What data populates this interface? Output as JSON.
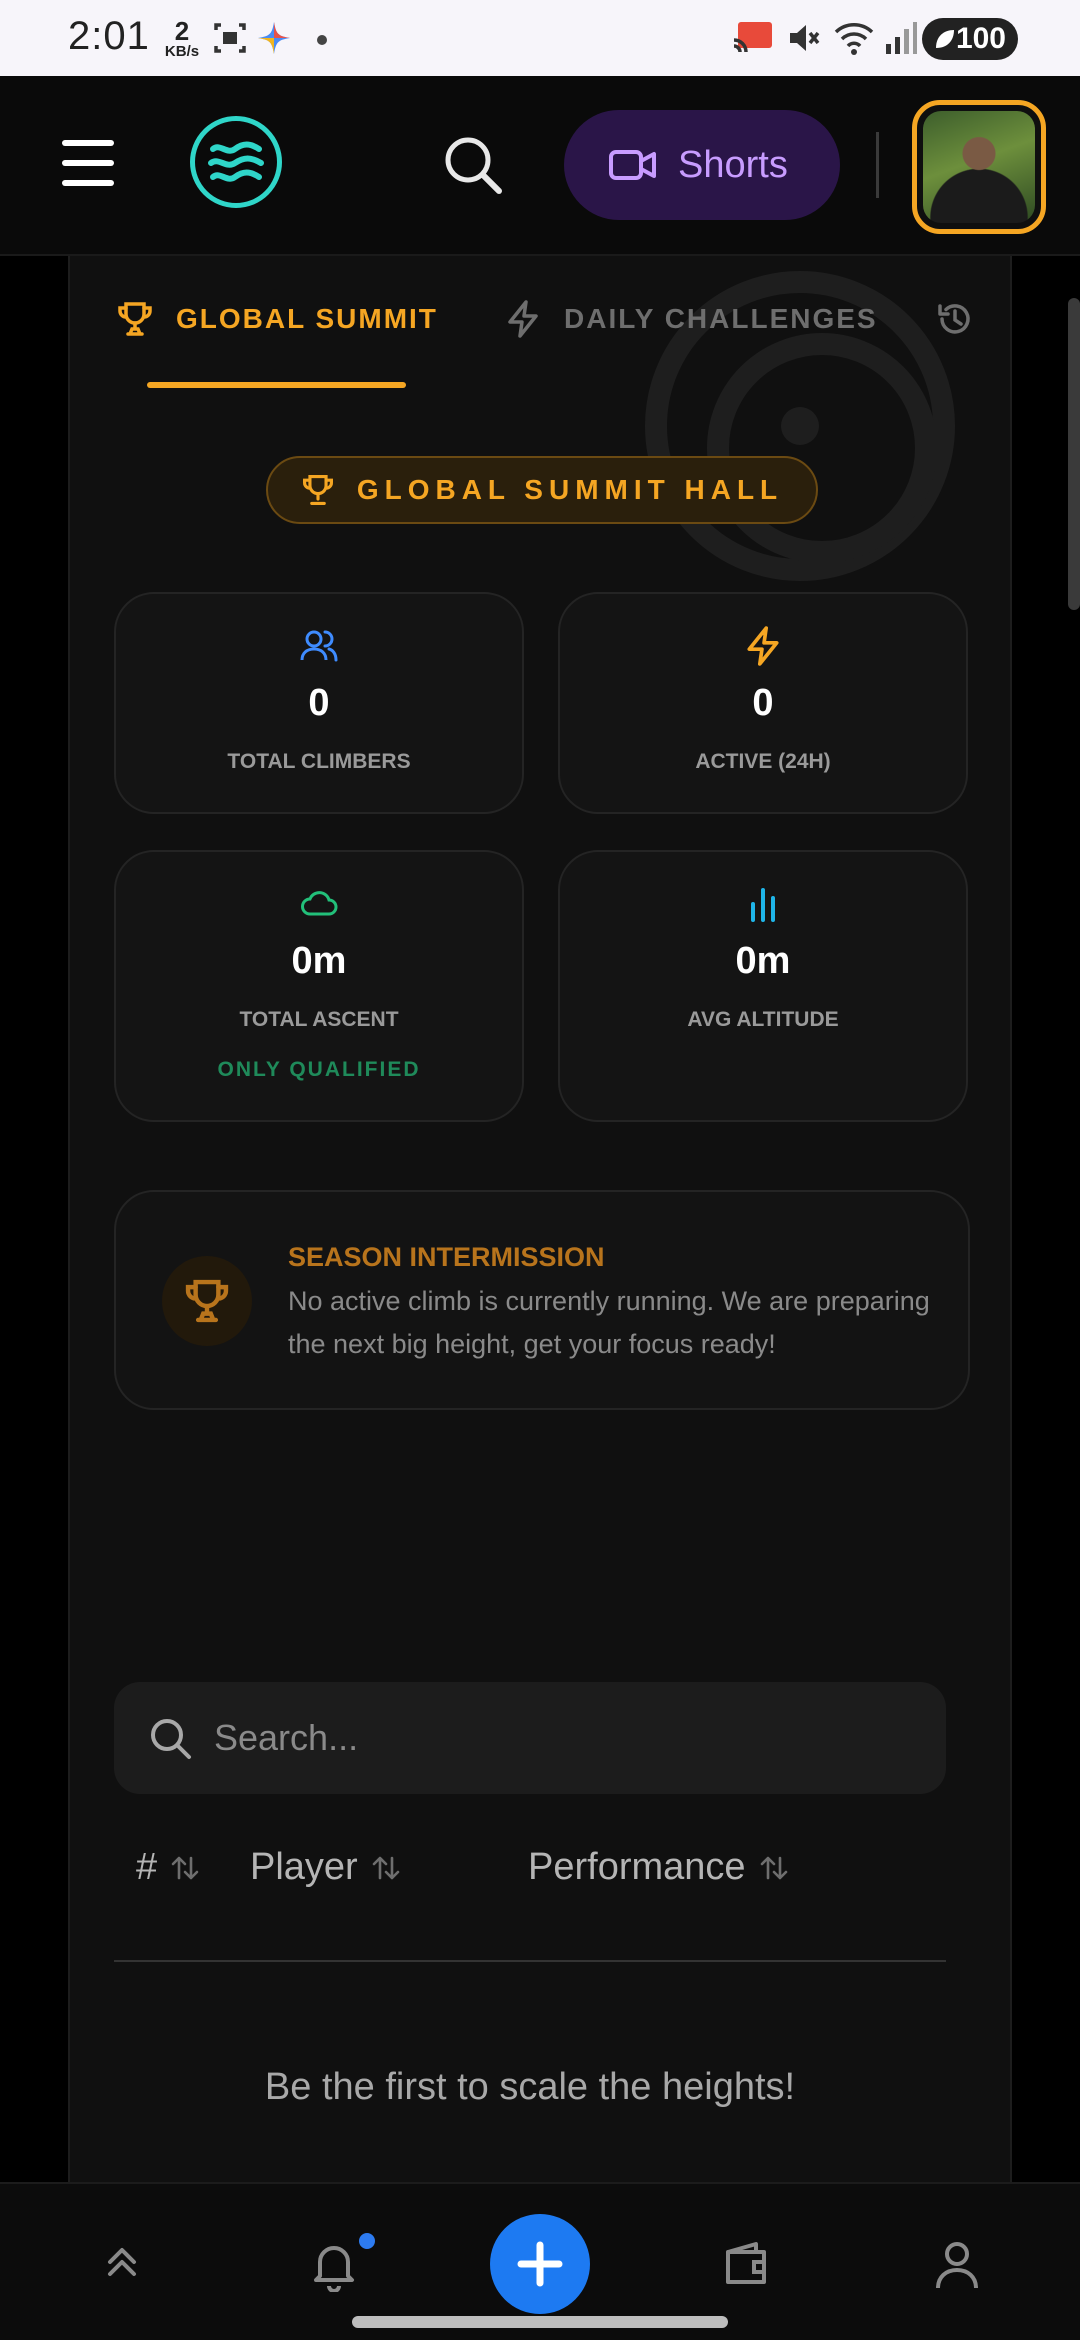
{
  "status_bar": {
    "time": "2:01",
    "net_speed_value": "2",
    "net_speed_unit": "KB/s",
    "battery": "100"
  },
  "header": {
    "shorts_label": "Shorts",
    "icons": [
      "menu-icon",
      "app-logo",
      "search-icon",
      "video-icon",
      "avatar"
    ]
  },
  "tabs": [
    {
      "label": "GLOBAL SUMMIT",
      "icon": "trophy-icon",
      "active": true
    },
    {
      "label": "DAILY CHALLENGES",
      "icon": "lightning-icon",
      "active": false
    }
  ],
  "hall_badge": "GLOBAL SUMMIT HALL",
  "stats": {
    "total_climbers": {
      "value": "0",
      "label": "TOTAL CLIMBERS",
      "icon": "users-icon",
      "color": "#3f8cff"
    },
    "active_24h": {
      "value": "0",
      "label": "ACTIVE (24H)",
      "icon": "lightning-icon",
      "color": "#f5a623"
    },
    "total_ascent": {
      "value": "0m",
      "label": "TOTAL ASCENT",
      "note": "ONLY QUALIFIED",
      "icon": "cloud-icon",
      "color": "#22c07a"
    },
    "avg_altitude": {
      "value": "0m",
      "label": "AVG ALTITUDE",
      "icon": "bar-chart-icon",
      "color": "#1fb5e8"
    }
  },
  "season": {
    "title": "SEASON INTERMISSION",
    "message": "No active climb is currently running. We are preparing the next big height, get your focus ready!"
  },
  "leaderboard": {
    "search_placeholder": "Search...",
    "columns": [
      "#",
      "Player",
      "Performance"
    ],
    "empty_message": "Be the first to scale the heights!"
  },
  "bottom_nav": {
    "items": [
      "chevrons-up-icon",
      "bell-icon",
      "plus-icon",
      "wallet-icon",
      "user-icon"
    ],
    "has_notification": true
  },
  "colors": {
    "accent": "#f5a623",
    "background": "#101010",
    "fab": "#1d7af2",
    "shorts_bg": "#2a1548"
  }
}
